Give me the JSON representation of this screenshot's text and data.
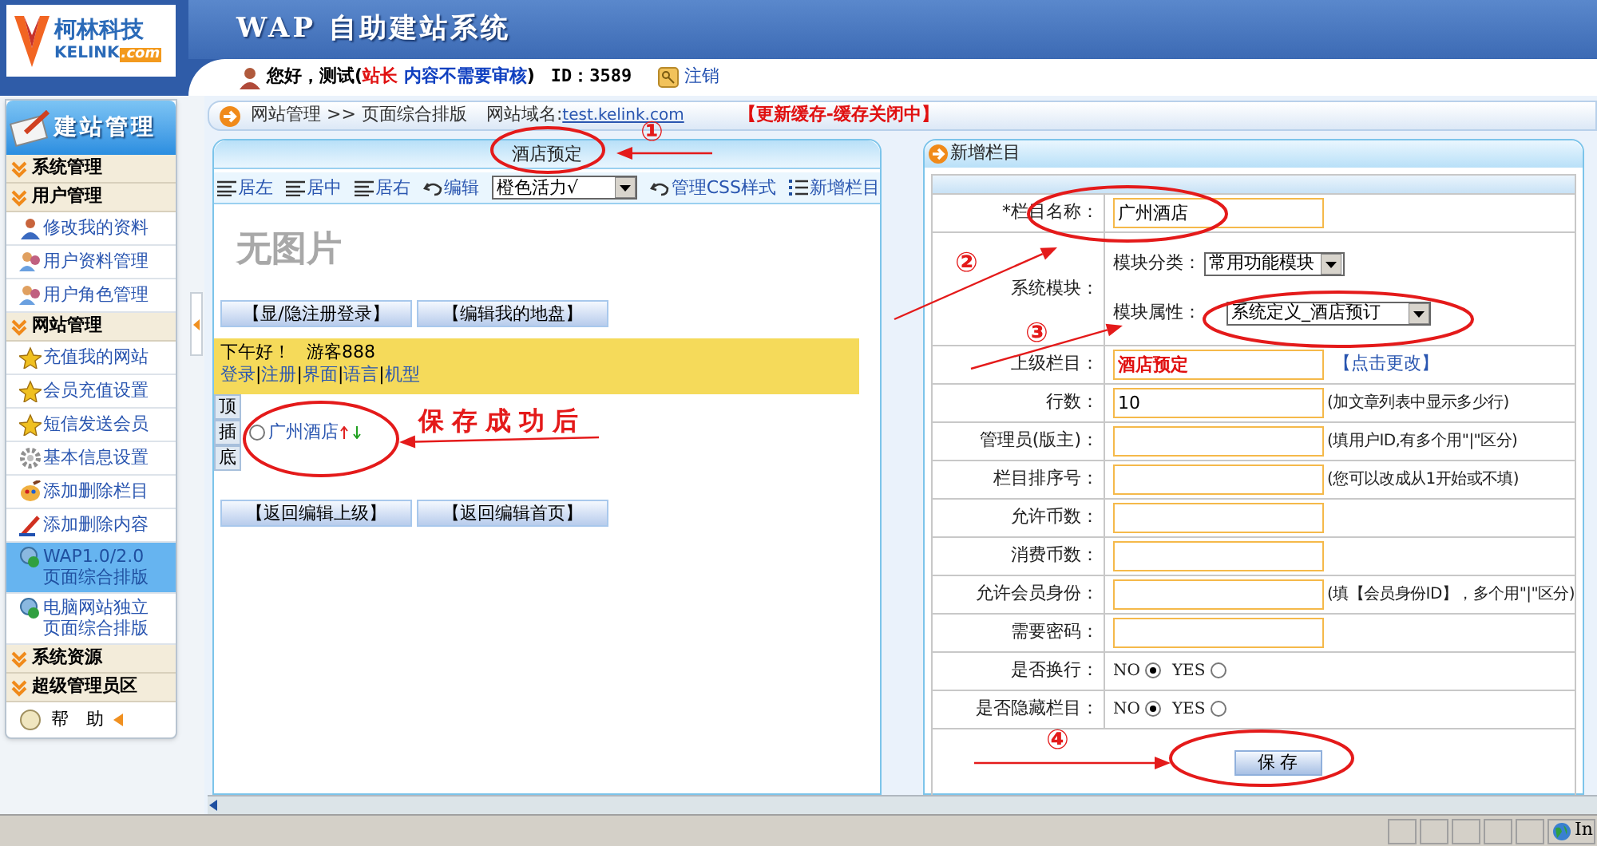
{
  "app": {
    "logo_name": "柯林科技",
    "logo_brand": "KELINK",
    "logo_domain": ".com",
    "title": "WAP 自助建站系统"
  },
  "user_bar": {
    "greeting": "您好，测试(",
    "role": "站长",
    "review": "内容不需要审核",
    "close": ")",
    "id": "ID：3589",
    "logout": "注销"
  },
  "sidebar": {
    "title": "建站管理",
    "sections": [
      {
        "label": "系统管理"
      },
      {
        "label": "用户管理",
        "items": [
          {
            "label": "修改我的资料",
            "kind": "user",
            "selected": false
          },
          {
            "label": "用户资料管理",
            "kind": "users",
            "selected": false
          },
          {
            "label": "用户角色管理",
            "kind": "users",
            "selected": false
          }
        ]
      },
      {
        "label": "网站管理",
        "items": [
          {
            "label": "充值我的网站",
            "kind": "star",
            "selected": false
          },
          {
            "label": "会员充值设置",
            "kind": "star",
            "selected": false
          },
          {
            "label": "短信发送会员",
            "kind": "star",
            "selected": false
          },
          {
            "label": "基本信息设置",
            "kind": "gear",
            "selected": false
          },
          {
            "label": "添加删除栏目",
            "kind": "palette",
            "selected": false
          },
          {
            "label": "添加删除内容",
            "kind": "pencil",
            "selected": false
          },
          {
            "label": "WAP1.0/2.0",
            "label_2": "页面综合排版",
            "kind": "globe",
            "selected": true
          },
          {
            "label": "电脑网站独立",
            "label_2": "页面综合排版",
            "kind": "globe",
            "selected": false
          }
        ]
      },
      {
        "label": "系统资源"
      },
      {
        "label": "超级管理员区"
      }
    ],
    "help": "帮　助"
  },
  "breadcrumb": {
    "path": "网站管理 >> 页面综合排版",
    "domain_label": "网站域名:",
    "domain": "test.kelink.com",
    "cache": "【更新缓存-缓存关闭中】"
  },
  "editor": {
    "title": "酒店预定",
    "toolbar": [
      {
        "kind": "align",
        "label": "居左"
      },
      {
        "kind": "align",
        "label": "居中"
      },
      {
        "kind": "align",
        "label": "居右"
      },
      {
        "kind": "undo",
        "label": "编辑"
      },
      {
        "kind": "select",
        "label": "橙色活力√"
      },
      {
        "kind": "undo",
        "label": "管理CSS样式"
      },
      {
        "kind": "list",
        "label": "新增栏目"
      }
    ],
    "image_placeholder": "无图片",
    "top_buttons": [
      "【显/隐注册登录】",
      "【编辑我的地盘】"
    ],
    "banner": {
      "greeting": "下午好！",
      "visitor": "游客888",
      "separator": "|",
      "links": [
        "登录",
        "注册",
        "界面",
        "语言",
        "机型"
      ]
    },
    "side_tabs": [
      "顶",
      "插",
      "底"
    ],
    "column": {
      "label": "广州酒店",
      "selected": false
    },
    "bottom_buttons": [
      "【返回编辑上级】",
      "【返回编辑首页】"
    ]
  },
  "form": {
    "title": "新增栏目",
    "rows": [
      {
        "kind": "input",
        "label": "*栏目名称：",
        "value": "广州酒店"
      },
      {
        "kind": "module",
        "label": "系统模块：",
        "category_label": "模块分类：",
        "category": "常用功能模块",
        "attribute_label": "模块属性：",
        "attribute": "系统定义_酒店预订"
      },
      {
        "kind": "parent",
        "label": "上级栏目：",
        "value": "酒店预定",
        "link": "【点击更改】"
      },
      {
        "kind": "input",
        "label": "行数：",
        "value": "10",
        "hint": "(加文章列表中显示多少行)"
      },
      {
        "kind": "input",
        "label": "管理员(版主)：",
        "hint": "(填用户ID,有多个用\"|\"区分)"
      },
      {
        "kind": "input",
        "label": "栏目排序号：",
        "hint": "(您可以改成从1开始或不填)"
      },
      {
        "kind": "input",
        "label": "允许币数："
      },
      {
        "kind": "input",
        "label": "消费币数："
      },
      {
        "kind": "input",
        "label": "允许会员身份：",
        "hint": "(填【会员身份ID】，多个用\"|\"区分)"
      },
      {
        "kind": "input",
        "label": "需要密码："
      },
      {
        "kind": "radio",
        "label": "是否换行：",
        "options": [
          {
            "label": "NO",
            "selected": true
          },
          {
            "label": "YES",
            "selected": false
          }
        ]
      },
      {
        "kind": "radio",
        "label": "是否隐藏栏目：",
        "options": [
          {
            "label": "NO",
            "selected": true
          },
          {
            "label": "YES",
            "selected": false
          }
        ]
      }
    ],
    "save": "保 存"
  },
  "annotations": {
    "markers": [
      "①",
      "②",
      "③",
      "④"
    ],
    "caption": "保存成功后"
  },
  "status_bar": {
    "zone": "In"
  }
}
